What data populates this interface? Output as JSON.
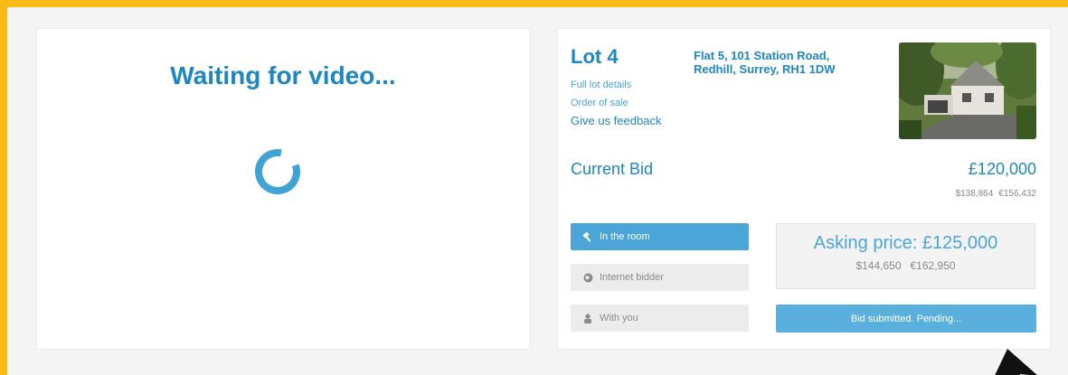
{
  "video": {
    "title": "Waiting for video..."
  },
  "lot": {
    "title": "Lot 4",
    "address_line1": "Flat 5, 101 Station Road,",
    "address_line2": "Redhill, Surrey, RH1 1DW",
    "links": {
      "full_details": "Full lot details",
      "order_of_sale": "Order of sale",
      "feedback": "Give us feedback"
    },
    "photo_icon": "house-photo"
  },
  "current_bid": {
    "label": "Current Bid",
    "value": "£120,000",
    "usd": "$138,864",
    "eur": "€156,432"
  },
  "bidders": [
    {
      "label": "In the room",
      "icon": "gavel-icon",
      "active": true
    },
    {
      "label": "Internet bidder",
      "icon": "globe-icon",
      "active": false
    },
    {
      "label": "With you",
      "icon": "user-icon",
      "active": false
    }
  ],
  "asking": {
    "label": "Asking price: £125,000",
    "usd": "$144,650",
    "eur": "€162,950"
  },
  "status": {
    "label": "Bid submitted. Pending..."
  },
  "colors": {
    "frame": "#fbb917",
    "accent": "#1e86c1",
    "button": "#4ba5d6"
  }
}
